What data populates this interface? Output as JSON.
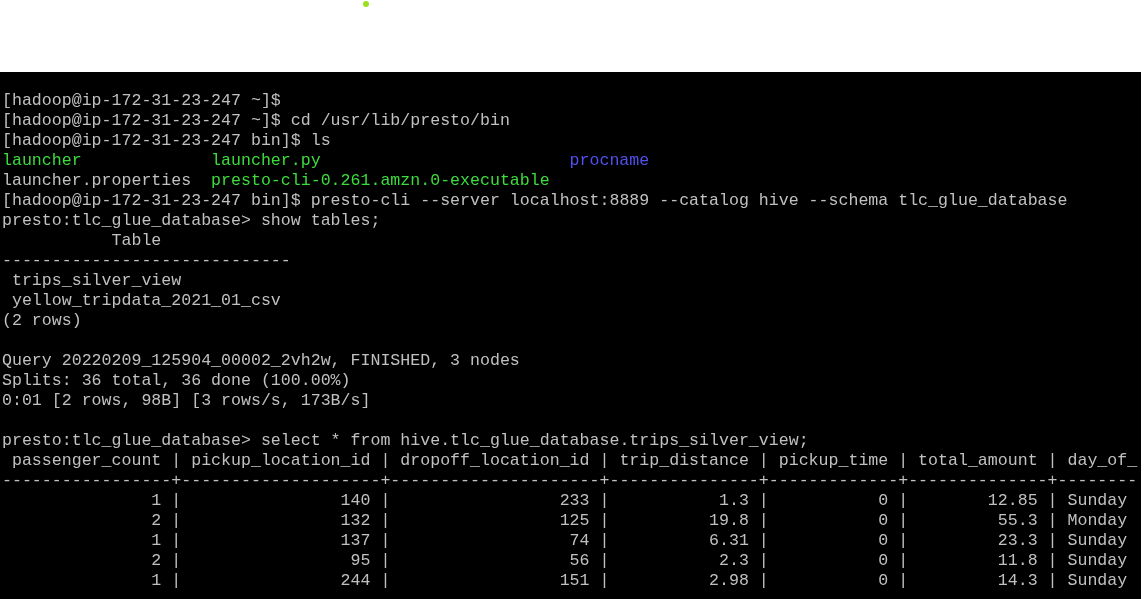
{
  "terminal": {
    "lines": [
      {
        "kind": "text",
        "text": "[hadoop@ip-172-31-23-247 ~]$"
      },
      {
        "kind": "text",
        "text": "[hadoop@ip-172-31-23-247 ~]$ cd /usr/lib/presto/bin"
      },
      {
        "kind": "text",
        "text": "[hadoop@ip-172-31-23-247 bin]$ ls"
      },
      {
        "kind": "listing",
        "entries": [
          {
            "text": "launcher",
            "color": "#3cdc3c"
          },
          {
            "text": "launcher.py",
            "color": "#3cdc3c"
          },
          {
            "text": "procname",
            "color": "#5050f0"
          }
        ]
      },
      {
        "kind": "listing",
        "entries": [
          {
            "text": "launcher.properties",
            "color": "#c0c0c0"
          },
          {
            "text": "presto-cli-0.261.amzn.0-executable",
            "color": "#3cdc3c"
          }
        ]
      },
      {
        "kind": "text",
        "text": "[hadoop@ip-172-31-23-247 bin]$ presto-cli --server localhost:8889 --catalog hive --schema tlc_glue_database"
      },
      {
        "kind": "text",
        "text": "presto:tlc_glue_database> show tables;"
      },
      {
        "kind": "text",
        "text": "           Table"
      },
      {
        "kind": "text",
        "text": "-----------------------------"
      },
      {
        "kind": "text",
        "text": " trips_silver_view"
      },
      {
        "kind": "text",
        "text": " yellow_tripdata_2021_01_csv"
      },
      {
        "kind": "text",
        "text": "(2 rows)"
      },
      {
        "kind": "blank"
      },
      {
        "kind": "text",
        "text": "Query 20220209_125904_00002_2vh2w, FINISHED, 3 nodes"
      },
      {
        "kind": "text",
        "text": "Splits: 36 total, 36 done (100.00%)"
      },
      {
        "kind": "text",
        "text": "0:01 [2 rows, 98B] [3 rows/s, 173B/s]"
      },
      {
        "kind": "blank"
      },
      {
        "kind": "text",
        "text": "presto:tlc_glue_database> select * from hive.tlc_glue_database.trips_silver_view;"
      },
      {
        "kind": "text",
        "text": " passenger_count | pickup_location_id | dropoff_location_id | trip_distance | pickup_time | total_amount | day_of_"
      },
      {
        "kind": "text",
        "text": "-----------------+--------------------+---------------------+---------------+-------------+--------------+--------"
      },
      {
        "kind": "text",
        "text": "               1 |                140 |                 233 |           1.3 |           0 |        12.85 | Sunday"
      },
      {
        "kind": "text",
        "text": "               2 |                132 |                 125 |          19.8 |           0 |         55.3 | Monday"
      },
      {
        "kind": "text",
        "text": "               1 |                137 |                  74 |          6.31 |           0 |         23.3 | Sunday"
      },
      {
        "kind": "text",
        "text": "               2 |                 95 |                  56 |           2.3 |           0 |         11.8 | Sunday"
      },
      {
        "kind": "text",
        "text": "               1 |                244 |                 151 |          2.98 |           0 |         14.3 | Sunday"
      }
    ]
  }
}
